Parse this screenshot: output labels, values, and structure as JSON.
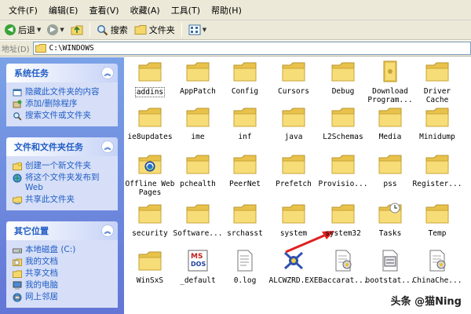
{
  "menu": [
    "文件(F)",
    "编辑(E)",
    "查看(V)",
    "收藏(A)",
    "工具(T)",
    "帮助(H)"
  ],
  "toolbar": {
    "back": "后退",
    "search": "搜索",
    "folders": "文件夹"
  },
  "address": {
    "label": "地址(D)",
    "path": "C:\\WINDOWS"
  },
  "sidebar": {
    "panels": [
      {
        "title": "系统任务",
        "items": [
          {
            "label": "隐藏此文件夹的内容",
            "icon": "hide-icon"
          },
          {
            "label": "添加/删除程序",
            "icon": "add-remove-icon"
          },
          {
            "label": "搜索文件或文件夹",
            "icon": "search-icon"
          }
        ]
      },
      {
        "title": "文件和文件夹任务",
        "items": [
          {
            "label": "创建一个新文件夹",
            "icon": "new-folder-icon"
          },
          {
            "label": "将这个文件夹发布到 Web",
            "icon": "publish-web-icon"
          },
          {
            "label": "共享此文件夹",
            "icon": "share-icon"
          }
        ]
      },
      {
        "title": "其它位置",
        "items": [
          {
            "label": "本地磁盘 (C:)",
            "icon": "disk-icon"
          },
          {
            "label": "我的文档",
            "icon": "my-documents-icon"
          },
          {
            "label": "共享文档",
            "icon": "shared-documents-icon"
          },
          {
            "label": "我的电脑",
            "icon": "my-computer-icon"
          },
          {
            "label": "网上邻居",
            "icon": "network-icon"
          }
        ]
      }
    ]
  },
  "files": [
    {
      "name": "addins",
      "icon": "folder",
      "selected": true
    },
    {
      "name": "AppPatch",
      "icon": "folder"
    },
    {
      "name": "Config",
      "icon": "folder"
    },
    {
      "name": "Cursors",
      "icon": "folder"
    },
    {
      "name": "Debug",
      "icon": "folder"
    },
    {
      "name": "Download\nProgram...",
      "icon": "folder-special"
    },
    {
      "name": "Driver\nCache",
      "icon": "folder"
    },
    {
      "name": "ie8updates",
      "icon": "folder"
    },
    {
      "name": "ime",
      "icon": "folder"
    },
    {
      "name": "inf",
      "icon": "folder"
    },
    {
      "name": "java",
      "icon": "folder"
    },
    {
      "name": "L2Schemas",
      "icon": "folder"
    },
    {
      "name": "Media",
      "icon": "folder"
    },
    {
      "name": "Minidump",
      "icon": "folder"
    },
    {
      "name": "Offline Web\nPages",
      "icon": "folder-offline"
    },
    {
      "name": "pchealth",
      "icon": "folder"
    },
    {
      "name": "PeerNet",
      "icon": "folder"
    },
    {
      "name": "Prefetch",
      "icon": "folder"
    },
    {
      "name": "Provisio...",
      "icon": "folder"
    },
    {
      "name": "pss",
      "icon": "folder"
    },
    {
      "name": "Register...",
      "icon": "folder"
    },
    {
      "name": "security",
      "icon": "folder"
    },
    {
      "name": "Software...",
      "icon": "folder"
    },
    {
      "name": "srchasst",
      "icon": "folder"
    },
    {
      "name": "system",
      "icon": "folder"
    },
    {
      "name": "system32",
      "icon": "folder"
    },
    {
      "name": "Tasks",
      "icon": "folder-tasks"
    },
    {
      "name": "Temp",
      "icon": "folder"
    },
    {
      "name": "WinSxS",
      "icon": "folder"
    },
    {
      "name": "_default",
      "icon": "msdos-file"
    },
    {
      "name": "0.log",
      "icon": "text-file"
    },
    {
      "name": "ALCWZRD.EXE",
      "icon": "exe-file"
    },
    {
      "name": "Baccarat...",
      "icon": "config-file"
    },
    {
      "name": "bootstat...",
      "icon": "binary-file"
    },
    {
      "name": "ChinaChe...",
      "icon": "config-file"
    }
  ],
  "watermark": "头条 @猫Ning",
  "colors": {
    "folder": "#f5d86a",
    "sidebar_bg": "#7ba2e7",
    "panel_title": "#215dc6",
    "arrow": "#e02020"
  }
}
